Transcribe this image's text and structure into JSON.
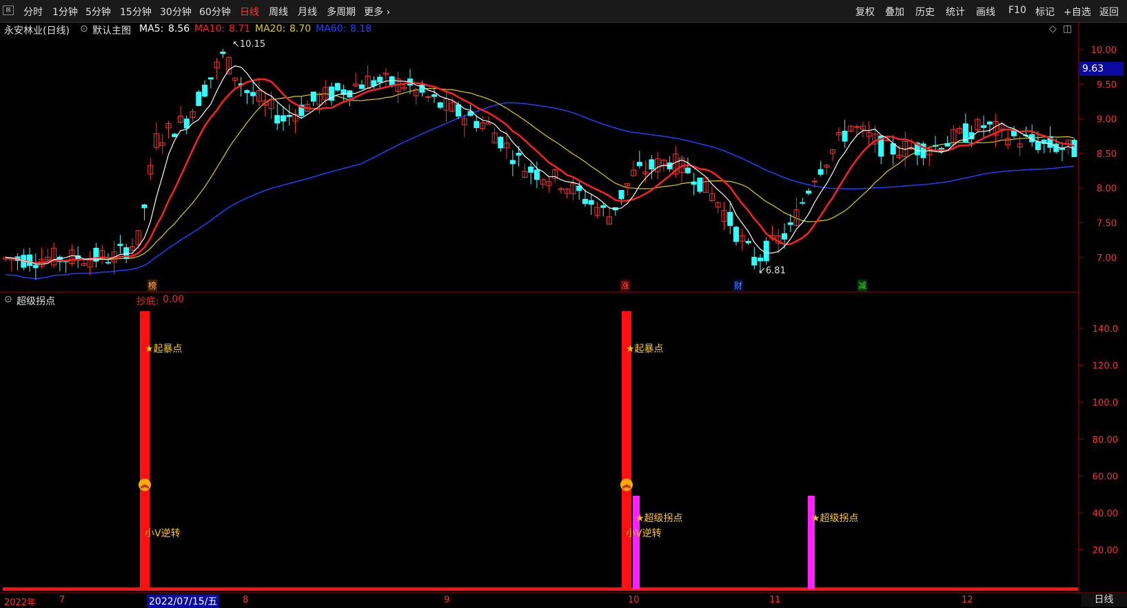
{
  "toolbar": {
    "periods": [
      "分时",
      "1分钟",
      "5分钟",
      "15分钟",
      "30分钟",
      "60分钟",
      "日线",
      "周线",
      "月线",
      "多周期",
      "更多 ›"
    ],
    "active_period": "日线",
    "right": [
      "复权",
      "叠加",
      "历史",
      "统计",
      "画线",
      "F10",
      "标记",
      "+自选",
      "返回"
    ],
    "corner": "⊠"
  },
  "info": {
    "stock": "永安林业(日线)",
    "template": "默认主图",
    "ma5_label": "MA5:",
    "ma5": "8.56",
    "ma10_label": "MA10:",
    "ma10": "8.71",
    "ma20_label": "MA20:",
    "ma20": "8.70",
    "ma60_label": "MA60:",
    "ma60": "8.18"
  },
  "colors": {
    "ma5": "#ffffff",
    "ma10": "#ff2020",
    "ma20": "#e0d000",
    "ma60": "#2040ff",
    "up": "#ff3030",
    "down": "#30ffff",
    "grid": "#aa0000"
  },
  "main_chart": {
    "y_ticks": [
      "10.00",
      "9.50",
      "9.00",
      "8.50",
      "8.00",
      "7.50",
      "7.00"
    ],
    "current_price": "9.63",
    "high_label": "10.15",
    "low_label": "6.81",
    "markers": [
      {
        "text": "榜",
        "color": "#ffaa60"
      },
      {
        "text": "涨",
        "color": "#ff5050"
      },
      {
        "text": "财",
        "color": "#5080ff"
      },
      {
        "text": "减",
        "color": "#40d040"
      }
    ]
  },
  "sub": {
    "title": "超级拐点",
    "value_label": "抄底:",
    "value": "0.00",
    "y_ticks": [
      "140.0",
      "120.0",
      "100.0",
      "80.00",
      "60.00",
      "40.00",
      "20.00"
    ],
    "labels": {
      "qibao": "★起暴点",
      "xiaov": "小V逆转",
      "chaoji": "★超级拐点"
    }
  },
  "xaxis": {
    "labels": [
      "2022年",
      "7",
      "2022/07/15/五",
      "8",
      "9",
      "10",
      "11",
      "12"
    ],
    "period": "日线"
  }
}
